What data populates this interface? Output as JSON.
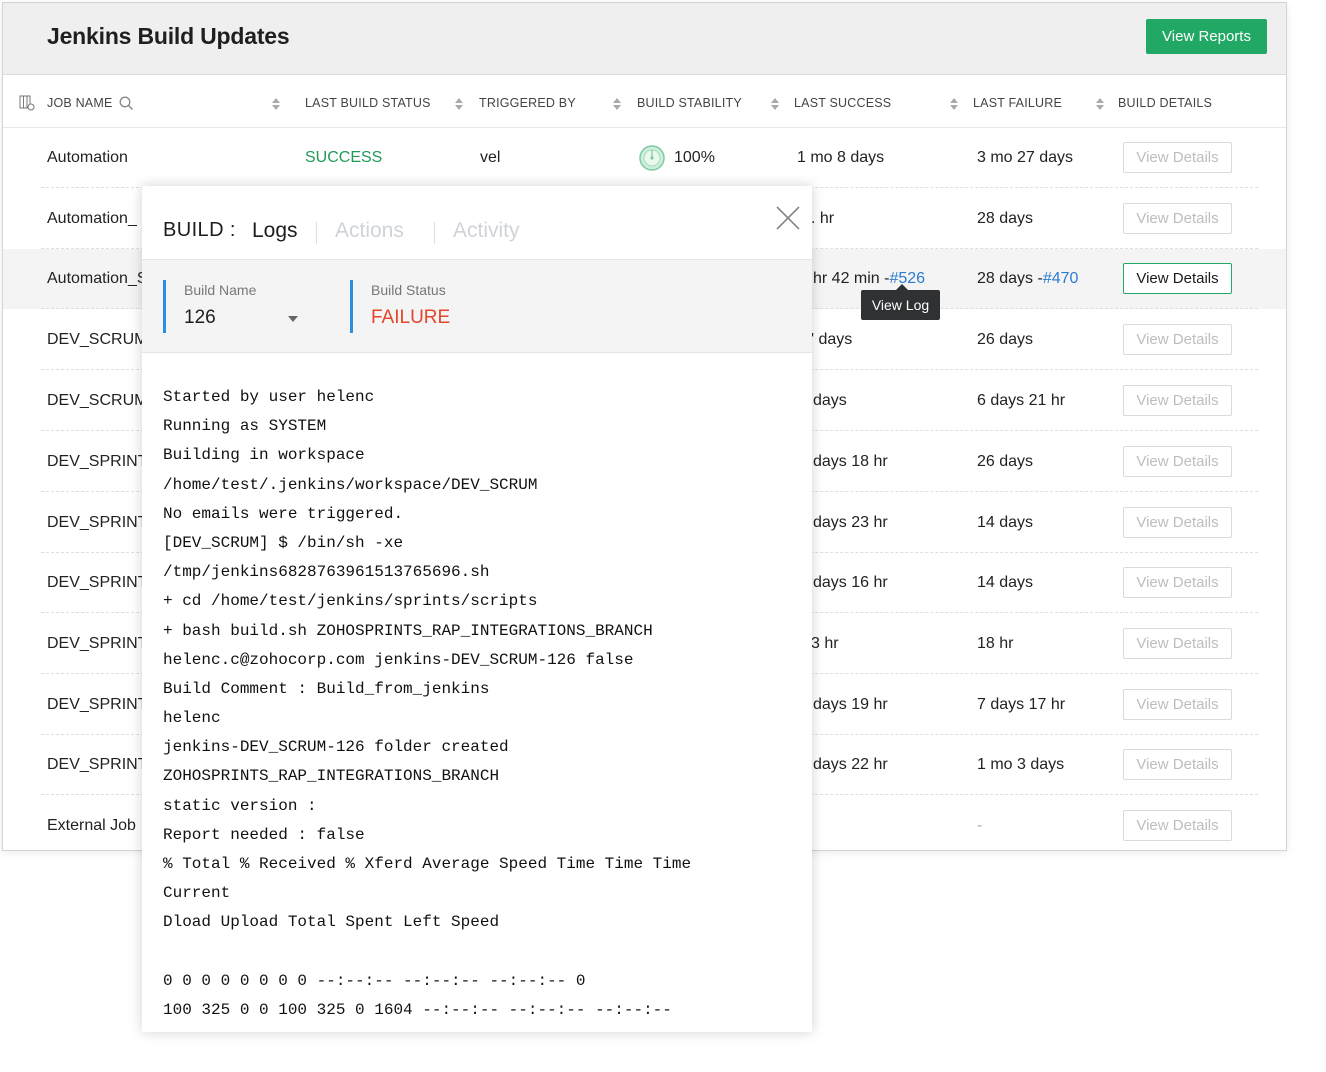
{
  "header": {
    "title": "Jenkins Build Updates",
    "reports_button": "View Reports"
  },
  "columns": {
    "job": "JOB NAME",
    "status": "LAST BUILD STATUS",
    "triggered": "TRIGGERED BY",
    "stability": "BUILD STABILITY",
    "success": "LAST SUCCESS",
    "failure": "LAST FAILURE",
    "details": "BUILD DETAILS"
  },
  "rows": [
    {
      "job": "Automation",
      "status": "SUCCESS",
      "triggered": "vel",
      "stability": "100%",
      "last_success": "1 mo 8 days",
      "last_failure": "3 mo 27 days",
      "details": "View Details"
    },
    {
      "job": "Automation_",
      "last_success": ". hr",
      "last_failure": "28 days",
      "details": "View Details"
    },
    {
      "job": "Automation_S",
      "last_success": "hr 42 min -",
      "success_link": "#526",
      "last_failure": "28 days -",
      "failure_link": "#470",
      "details": "View Details"
    },
    {
      "job": "DEV_SCRUM",
      "last_success": "' days",
      "last_failure": "26 days",
      "details": "View Details"
    },
    {
      "job": "DEV_SCRUM",
      "last_success": "days",
      "last_failure": "6 days 21 hr",
      "details": "View Details"
    },
    {
      "job": "DEV_SPRINT",
      "last_success": "days 18 hr",
      "last_failure": "26 days",
      "details": "View Details"
    },
    {
      "job": "DEV_SPRINT",
      "last_success": "days 23 hr",
      "last_failure": "14 days",
      "details": "View Details"
    },
    {
      "job": "DEV_SPRINT",
      "last_success": "days 16 hr",
      "last_failure": "14 days",
      "details": "View Details"
    },
    {
      "job": "DEV_SPRINT",
      "last_success": "3 hr",
      "last_failure": "18 hr",
      "details": "View Details"
    },
    {
      "job": "DEV_SPRINT",
      "last_success": "days 19 hr",
      "last_failure": "7 days 17 hr",
      "details": "View Details"
    },
    {
      "job": "DEV_SPRINT",
      "last_success": "days 22 hr",
      "last_failure": "1 mo 3 days",
      "details": "View Details"
    },
    {
      "job": "External Job",
      "last_success": "",
      "last_failure": "-",
      "details": "View Details"
    }
  ],
  "tooltip": "View Log",
  "build_panel": {
    "title": "BUILD :",
    "tabs": [
      "Logs",
      "Actions",
      "Activity"
    ],
    "build_name_label": "Build Name",
    "build_name_value": "126",
    "build_status_label": "Build Status",
    "build_status_value": "FAILURE",
    "log_lines": [
      "Started by user helenc",
      "Running as SYSTEM",
      "Building in workspace",
      "/home/test/.jenkins/workspace/DEV_SCRUM",
      "No emails were triggered.",
      "[DEV_SCRUM] $ /bin/sh -xe",
      "/tmp/jenkins6828763961513765696.sh",
      "+ cd /home/test/jenkins/sprints/scripts",
      "+ bash build.sh ZOHOSPRINTS_RAP_INTEGRATIONS_BRANCH",
      "helenc.c@zohocorp.com jenkins-DEV_SCRUM-126 false",
      "Build Comment : Build_from_jenkins",
      "helenc",
      "jenkins-DEV_SCRUM-126 folder created",
      "ZOHOSPRINTS_RAP_INTEGRATIONS_BRANCH",
      "static version :",
      "Report needed : false",
      "% Total % Received % Xferd Average Speed Time Time Time",
      "Current",
      "Dload Upload Total Spent Left Speed",
      "",
      "0 0 0 0 0 0 0 0 --:--:-- --:--:-- --:--:-- 0",
      "100 325 0 0 100 325 0 1604 --:--:-- --:--:-- --:--:--"
    ]
  },
  "colors": {
    "accent": "#21a864",
    "failure": "#e4452b",
    "link": "#2a7bd1",
    "status_bar": "#2a8fe0"
  }
}
